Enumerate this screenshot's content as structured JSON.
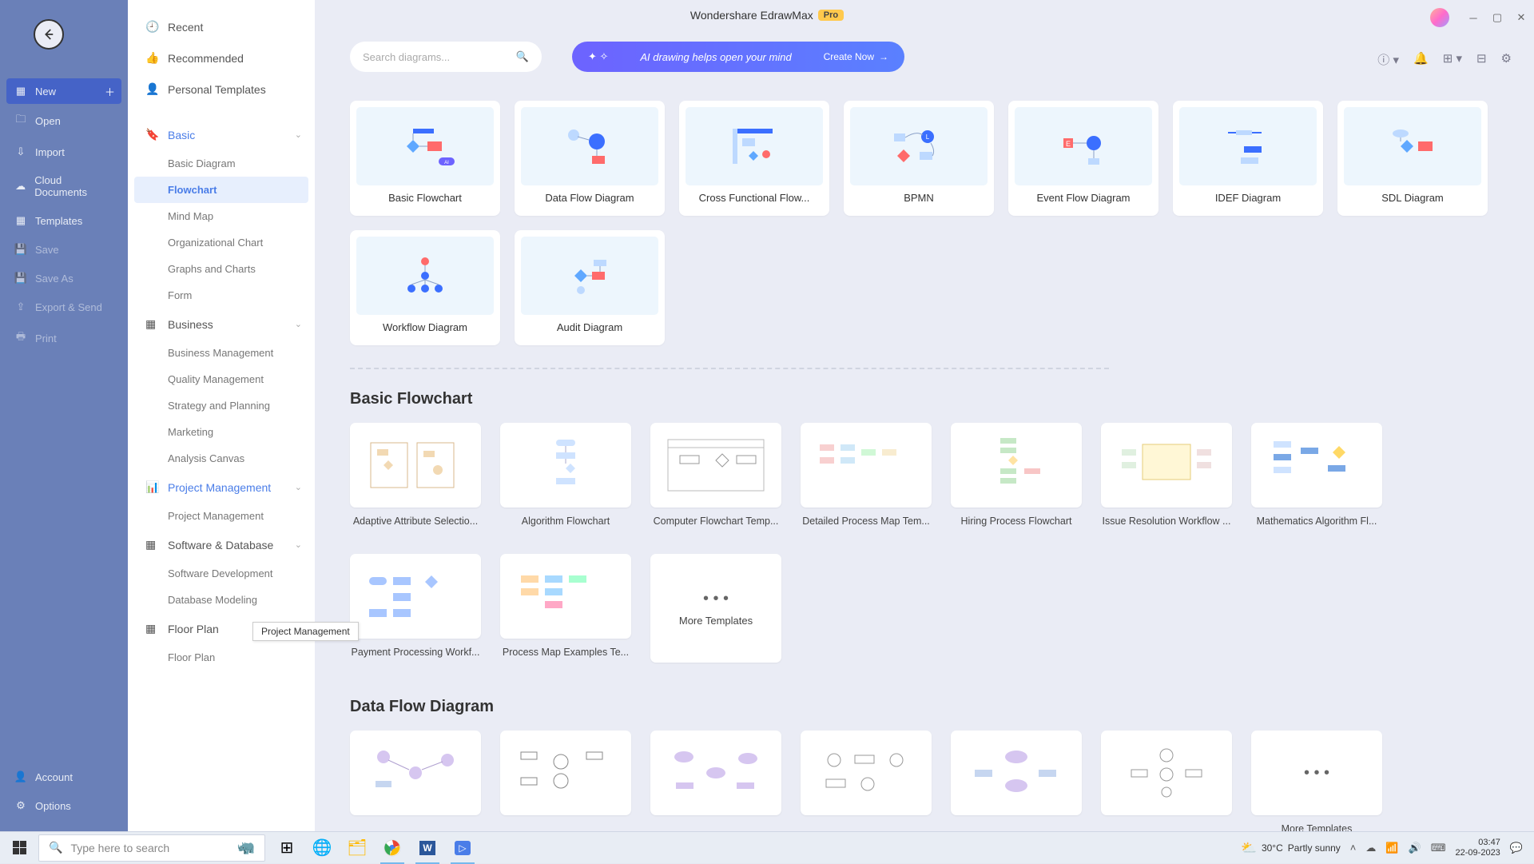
{
  "title": {
    "app": "Wondershare EdrawMax",
    "pro": "Pro"
  },
  "narrow": {
    "new": "New",
    "open": "Open",
    "import": "Import",
    "cloud": "Cloud Documents",
    "templates": "Templates",
    "save": "Save",
    "saveas": "Save As",
    "export": "Export & Send",
    "print": "Print",
    "account": "Account",
    "options": "Options"
  },
  "cat": {
    "recent": "Recent",
    "recommended": "Recommended",
    "personal": "Personal Templates",
    "basic": "Basic",
    "basic_items": {
      "diagram": "Basic Diagram",
      "flowchart": "Flowchart",
      "mindmap": "Mind Map",
      "org": "Organizational Chart",
      "graphs": "Graphs and Charts",
      "form": "Form"
    },
    "business": "Business",
    "business_items": {
      "mgmt": "Business Management",
      "quality": "Quality Management",
      "strategy": "Strategy and Planning",
      "marketing": "Marketing",
      "analysis": "Analysis Canvas"
    },
    "pm": "Project Management",
    "pm_items": {
      "pm": "Project Management"
    },
    "sd": "Software & Database",
    "sd_items": {
      "dev": "Software Development",
      "db": "Database Modeling"
    },
    "floor": "Floor Plan",
    "floor_items": {
      "fp": "Floor Plan"
    }
  },
  "tooltip": "Project Management",
  "search": {
    "placeholder": "Search diagrams..."
  },
  "ai": {
    "text": "AI drawing helps open your mind",
    "cta": "Create Now"
  },
  "types": {
    "r1": [
      "Basic Flowchart",
      "Data Flow Diagram",
      "Cross Functional Flow...",
      "BPMN",
      "Event Flow Diagram",
      "IDEF Diagram",
      "SDL Diagram"
    ],
    "r2": [
      "Workflow Diagram",
      "Audit Diagram"
    ]
  },
  "sections": {
    "bf": {
      "title": "Basic Flowchart",
      "items": [
        "Adaptive Attribute Selectio...",
        "Algorithm Flowchart",
        "Computer Flowchart Temp...",
        "Detailed Process Map Tem...",
        "Hiring Process Flowchart",
        "Issue Resolution Workflow ...",
        "Mathematics Algorithm Fl..."
      ],
      "items2": [
        "Payment Processing Workf...",
        "Process Map Examples Te..."
      ],
      "more": "More Templates"
    },
    "dfd": {
      "title": "Data Flow Diagram",
      "more": "More Templates"
    }
  },
  "taskbar": {
    "search": "Type here to search",
    "weather": {
      "temp": "30°C",
      "desc": "Partly sunny"
    },
    "time": "03:47",
    "date": "22-09-2023"
  }
}
